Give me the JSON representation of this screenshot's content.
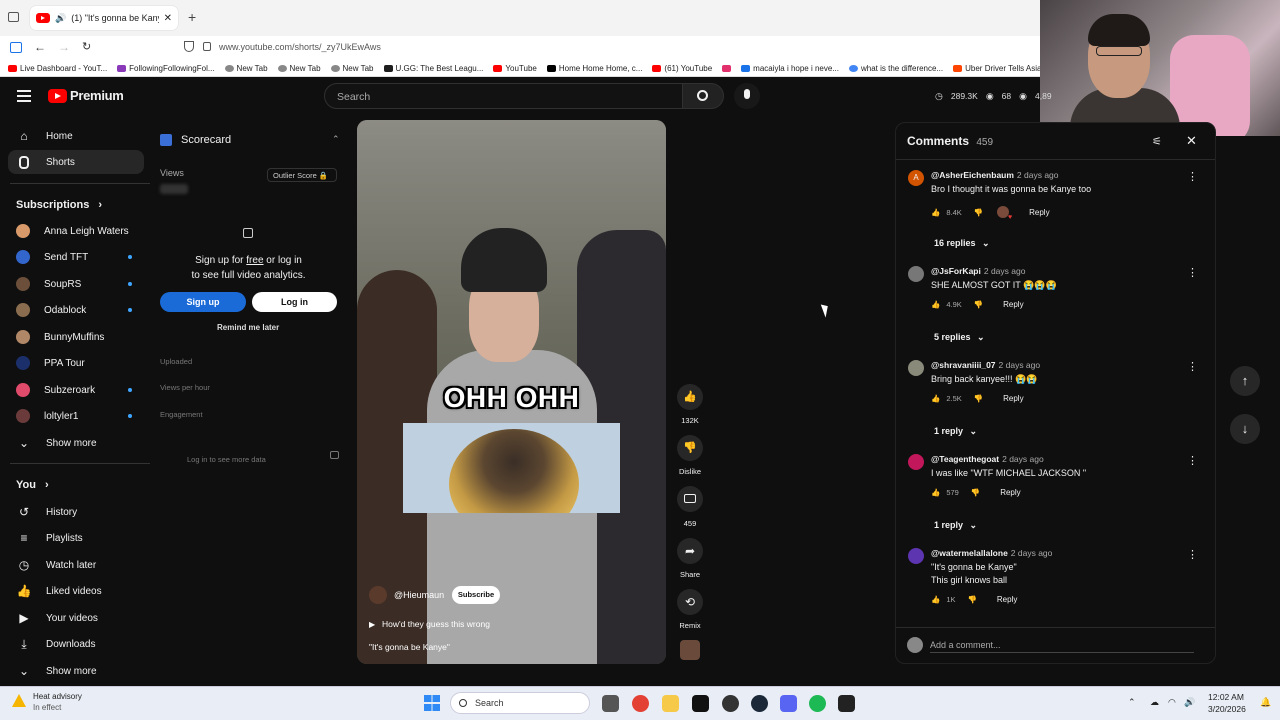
{
  "browser": {
    "tab_title": "(1) \"It's gonna be Kanye\"",
    "tab_icons": "yt-icon, mute-icon, close-icon",
    "new_tab": "+",
    "url": "www.youtube.com/shorts/_zy7UkEwAws",
    "bookmarks": [
      {
        "label": "Live Dashboard - YouT...",
        "color": "#ff0000"
      },
      {
        "label": "FollowingFollowingFol...",
        "color": "#8a3ab9"
      },
      {
        "label": "New Tab",
        "color": "#4285f4"
      },
      {
        "label": "New Tab",
        "color": "#4285f4"
      },
      {
        "label": "New Tab",
        "color": "#4285f4"
      },
      {
        "label": "U.GG: The Best Leagu...",
        "color": "#1e1e1e"
      },
      {
        "label": "YouTube",
        "color": "#ff0000"
      },
      {
        "label": "Home Home Home, c...",
        "color": "#000000"
      },
      {
        "label": "(61) YouTube",
        "color": "#ff0000"
      },
      {
        "label": "",
        "color": "#e1306c"
      },
      {
        "label": "macaiyla i hope i neve...",
        "color": "#1a73e8"
      },
      {
        "label": "what is the difference...",
        "color": "#4285f4"
      },
      {
        "label": "Uber Driver Tells Asian...",
        "color": "#ff4500"
      }
    ]
  },
  "yt": {
    "logo": "Premium",
    "search_placeholder": "Search",
    "stats": [
      "289.3K",
      "68",
      "4,89"
    ]
  },
  "sidebar": {
    "items": [
      {
        "label": "Home",
        "icon": "home-icon"
      },
      {
        "label": "Shorts",
        "icon": "shorts-icon"
      }
    ],
    "subs_title": "Subscriptions",
    "subs": [
      {
        "label": "Anna Leigh Waters",
        "color": "#d89a6a",
        "dot": false
      },
      {
        "label": "Send TFT",
        "color": "#3366cc",
        "dot": true
      },
      {
        "label": "SoupRS",
        "color": "#6b4f3a",
        "dot": true
      },
      {
        "label": "Odablock",
        "color": "#8a6d4e",
        "dot": true
      },
      {
        "label": "BunnyMuffins",
        "color": "#b08868",
        "dot": false
      },
      {
        "label": "PPA Tour",
        "color": "#1b2f6b",
        "dot": false
      },
      {
        "label": "Subzeroark",
        "color": "#e04a6b",
        "dot": true
      },
      {
        "label": "loltyler1",
        "color": "#6b3b3b",
        "dot": true
      }
    ],
    "show_more": "Show more",
    "you_title": "You",
    "you_items": [
      {
        "label": "History",
        "icon": "history-icon"
      },
      {
        "label": "Playlists",
        "icon": "playlists-icon"
      },
      {
        "label": "Watch later",
        "icon": "watch-later-icon"
      },
      {
        "label": "Liked videos",
        "icon": "liked-icon"
      },
      {
        "label": "Your videos",
        "icon": "your-videos-icon"
      },
      {
        "label": "Downloads",
        "icon": "downloads-icon"
      }
    ],
    "show_more2": "Show more"
  },
  "scorecard": {
    "title": "Scorecard",
    "views_label": "Views",
    "outlier": "Outlier Score",
    "signup_line1": "Sign up for",
    "signup_free": "free",
    "signup_line1b": "or log in",
    "signup_line2": "to see full video analytics.",
    "signup_btn": "Sign up",
    "login_btn": "Log in",
    "remind": "Remind me later",
    "uploaded": "Uploaded",
    "views_per_hour": "Views per hour",
    "engagement": "Engagement",
    "login_more": "Log in to see more data"
  },
  "video": {
    "caption": "OHH OHH",
    "channel": "@Hieumaun",
    "subscribe": "Subscribe",
    "title": "How'd they guess this wrong",
    "subtitle": "\"It's gonna be Kanye\""
  },
  "actions": {
    "likes": "132K",
    "dislike": "Dislike",
    "comments": "459",
    "share": "Share",
    "remix": "Remix"
  },
  "comments": {
    "title": "Comments",
    "count": "459",
    "list": [
      {
        "user": "@AsherEichenbaum",
        "time": "2 days ago",
        "text": "Bro I thought it was gonna be Kanye too",
        "likes": "8.4K",
        "replies": "16 replies",
        "avatar": "#d35400",
        "initial": "A",
        "hearted": true
      },
      {
        "user": "@JsForKapi",
        "time": "2 days ago",
        "text": "SHE ALMOST GOT IT 😭😭😭",
        "likes": "4.9K",
        "replies": "5 replies",
        "avatar": "#777",
        "initial": "",
        "hearted": false
      },
      {
        "user": "@shravaniiii_07",
        "time": "2 days ago",
        "text": "Bring back kanyee!!! 😭😭",
        "likes": "2.5K",
        "replies": "1 reply",
        "avatar": "#8a8a7a",
        "initial": "",
        "hearted": false
      },
      {
        "user": "@Teagenthegoat",
        "time": "2 days ago",
        "text": "I was like \"WTF MICHAEL JACKSON \"",
        "likes": "579",
        "replies": "1 reply",
        "avatar": "#c2185b",
        "initial": "",
        "hearted": false
      },
      {
        "user": "@watermelallalone",
        "time": "2 days ago",
        "text": "\"It's gonna be Kanye\"",
        "text2": "This girl knows ball",
        "likes": "1K",
        "replies": "",
        "avatar": "#5e35b1",
        "initial": "",
        "hearted": false
      }
    ],
    "reply_label": "Reply",
    "add_placeholder": "Add a comment..."
  },
  "taskbar": {
    "weather_line1": "Heat advisory",
    "weather_line2": "In effect",
    "search": "Search",
    "time": "12:02 AM",
    "date": "3/20/2026"
  }
}
